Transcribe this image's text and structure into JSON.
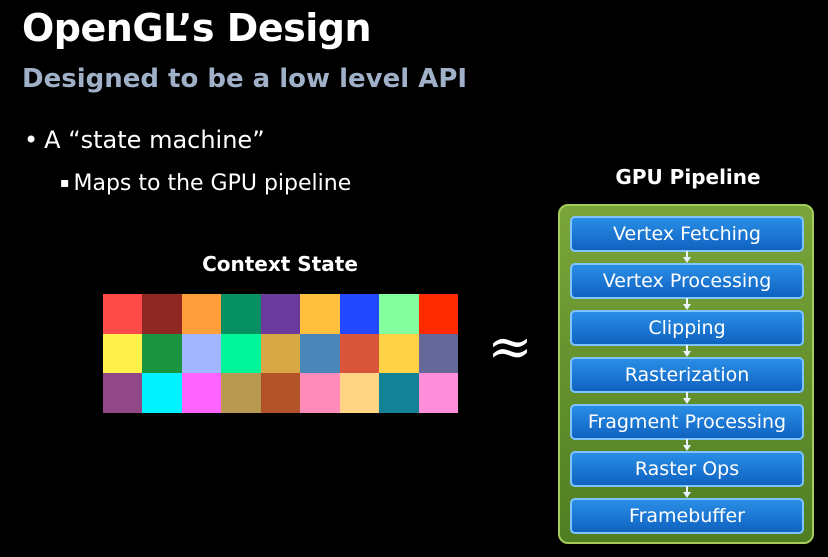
{
  "slide": {
    "title": "OpenGL’s Design",
    "subtitle": "Designed to be a low level API",
    "bullets": [
      {
        "mark": "•",
        "text": "A “state machine”"
      },
      {
        "mark": "▪",
        "text": "Maps to the GPU pipeline"
      }
    ]
  },
  "context_state": {
    "label": "Context State",
    "colors": [
      "#ff4a4a",
      "#8f2823",
      "#ff9e3b",
      "#079062",
      "#6a3a9c",
      "#ffc13d",
      "#2448ff",
      "#83ffa0",
      "#ff2a00",
      "#fff04a",
      "#1b943f",
      "#a2b6ff",
      "#00f59a",
      "#d8a846",
      "#4a86b8",
      "#d8543a",
      "#ffd144",
      "#64699a",
      "#914886",
      "#00f3ff",
      "#ff63ff",
      "#b8994f",
      "#b3532a",
      "#ff8bb8",
      "#ffd585",
      "#138196",
      "#ff8fda"
    ]
  },
  "approx_symbol": "≈",
  "pipeline": {
    "label": "GPU Pipeline",
    "stages": [
      "Vertex Fetching",
      "Vertex Processing",
      "Clipping",
      "Rasterization",
      "Fragment Processing",
      "Raster Ops",
      "Framebuffer"
    ]
  }
}
